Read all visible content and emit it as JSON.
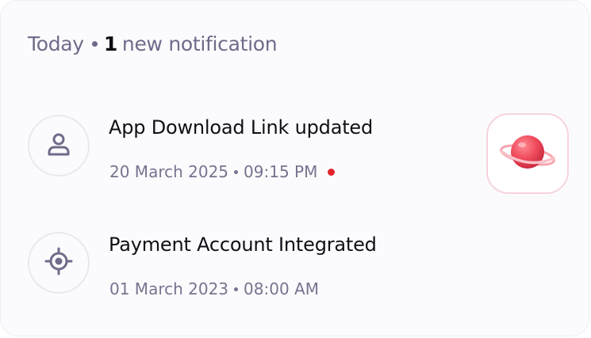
{
  "header": {
    "label": "Today",
    "count": "1",
    "suffix": "new notification"
  },
  "notifications": [
    {
      "title": "App Download Link updated",
      "date": "20 March 2025",
      "time": "09:15 PM",
      "unread": true,
      "icon": "user-icon",
      "thumbnail_icon": "planet-icon"
    },
    {
      "title": "Payment Account Integrated",
      "date": "01 March 2023",
      "time": "08:00 AM",
      "unread": false,
      "icon": "target-icon"
    }
  ],
  "colors": {
    "text_primary": "#0f0f17",
    "text_secondary": "#77738f",
    "unread": "#e3242b",
    "planet": "#ef4b5c"
  }
}
